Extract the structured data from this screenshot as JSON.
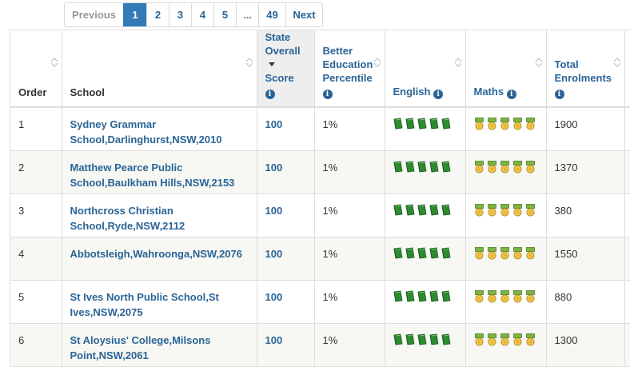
{
  "pagination": {
    "previous": "Previous",
    "pages": [
      "1",
      "2",
      "3",
      "4",
      "5",
      "...",
      "49"
    ],
    "active": "1",
    "next": "Next"
  },
  "columns": {
    "order": "Order",
    "school": "School",
    "state_score": [
      "State",
      "Overall",
      "Score"
    ],
    "better_edu": [
      "Better",
      "Education",
      "Percentile"
    ],
    "english": "English",
    "maths": "Maths",
    "enrolments": [
      "Total",
      "Enrolments"
    ]
  },
  "rows": [
    {
      "order": "1",
      "school": [
        "Sydney Grammar",
        "School,Darlinghurst,NSW,2010"
      ],
      "score": "100",
      "percentile": "1%",
      "english_rating": 5,
      "maths_rating": 5,
      "enrolments": "1900"
    },
    {
      "order": "2",
      "school": [
        "Matthew Pearce Public",
        "School,Baulkham Hills,NSW,2153"
      ],
      "score": "100",
      "percentile": "1%",
      "english_rating": 5,
      "maths_rating": 5,
      "enrolments": "1370"
    },
    {
      "order": "3",
      "school": [
        "Northcross Christian",
        "School,Ryde,NSW,2112"
      ],
      "score": "100",
      "percentile": "1%",
      "english_rating": 5,
      "maths_rating": 5,
      "enrolments": "380"
    },
    {
      "order": "4",
      "school": [
        "Abbotsleigh,Wahroonga,NSW,2076",
        ""
      ],
      "score": "100",
      "percentile": "1%",
      "english_rating": 5,
      "maths_rating": 5,
      "enrolments": "1550"
    },
    {
      "order": "5",
      "school": [
        "St Ives North Public School,St",
        "Ives,NSW,2075"
      ],
      "score": "100",
      "percentile": "1%",
      "english_rating": 5,
      "maths_rating": 5,
      "enrolments": "880"
    },
    {
      "order": "6",
      "school": [
        "St Aloysius' College,Milsons",
        "Point,NSW,2061"
      ],
      "score": "100",
      "percentile": "1%",
      "english_rating": 5,
      "maths_rating": 5,
      "enrolments": "1300"
    }
  ],
  "icons": {
    "info": "info-icon",
    "english": "green-book-icon",
    "maths": "gold-medal-icon",
    "sort": "sort-arrows-icon",
    "sort_desc": "caret-down-icon"
  },
  "colors": {
    "link": "#2a6496",
    "active_page": "#337ab7",
    "book_green": "#2e8b2e",
    "medal_gold": "#f2c94c",
    "medal_ribbon": "#7cb342"
  }
}
